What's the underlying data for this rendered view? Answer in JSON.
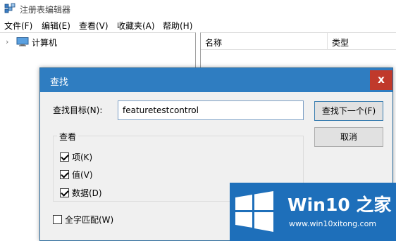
{
  "app": {
    "title": "注册表编辑器",
    "menu": [
      "文件(F)",
      "编辑(E)",
      "查看(V)",
      "收藏夹(A)",
      "帮助(H)"
    ]
  },
  "tree": {
    "root_label": "计算机",
    "root_icon": "computer-icon"
  },
  "list": {
    "columns": [
      "名称",
      "类型"
    ]
  },
  "dialog": {
    "title": "查找",
    "close_label": "x",
    "find_label": "查找目标(N):",
    "find_value": "featuretestcontrol",
    "find_next_label": "查找下一个(F)",
    "cancel_label": "取消",
    "look_at_title": "查看",
    "options": [
      {
        "label": "项(K)",
        "checked": true
      },
      {
        "label": "值(V)",
        "checked": true
      },
      {
        "label": "数据(D)",
        "checked": true
      }
    ],
    "match_whole": {
      "label": "全字匹配(W)",
      "checked": false
    }
  },
  "watermark": {
    "title": "Win10 之家",
    "url": "www.win10xitong.com"
  },
  "colors": {
    "dialog_titlebar": "#2f7dc1",
    "close_button": "#c0392b",
    "watermark_bg": "#1e6fba"
  }
}
